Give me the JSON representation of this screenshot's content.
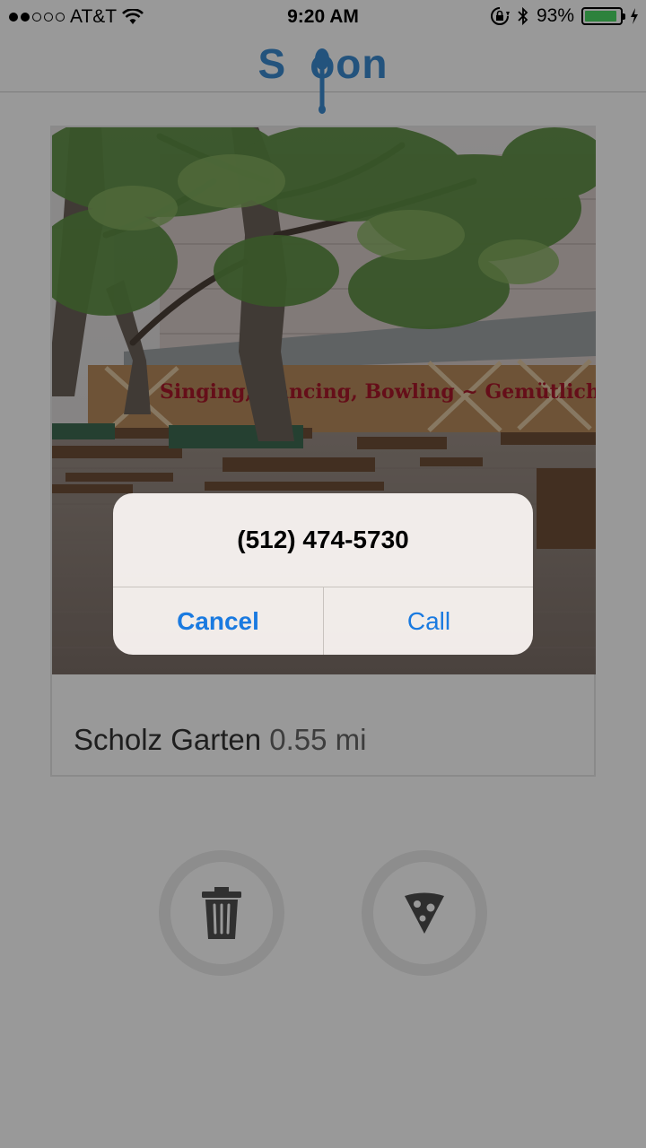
{
  "status": {
    "carrier": "AT&T",
    "time": "9:20 AM",
    "battery_pct": "93%",
    "battery_level": 0.93,
    "signal_bars": 2
  },
  "app": {
    "logo_left": "S",
    "logo_right": "oon",
    "brand_color": "#3b8bd0"
  },
  "card": {
    "name": "Scholz Garten",
    "distance": "0.55 mi",
    "sign_text": "Singing, Dancing, Bowling ~ Gemütlichkeit!"
  },
  "actions": {
    "discard_icon": "trash-icon",
    "eat_icon": "pizza-icon"
  },
  "alert": {
    "title": "(512) 474-5730",
    "cancel": "Cancel",
    "call": "Call",
    "button_color": "#1a7ae0"
  }
}
